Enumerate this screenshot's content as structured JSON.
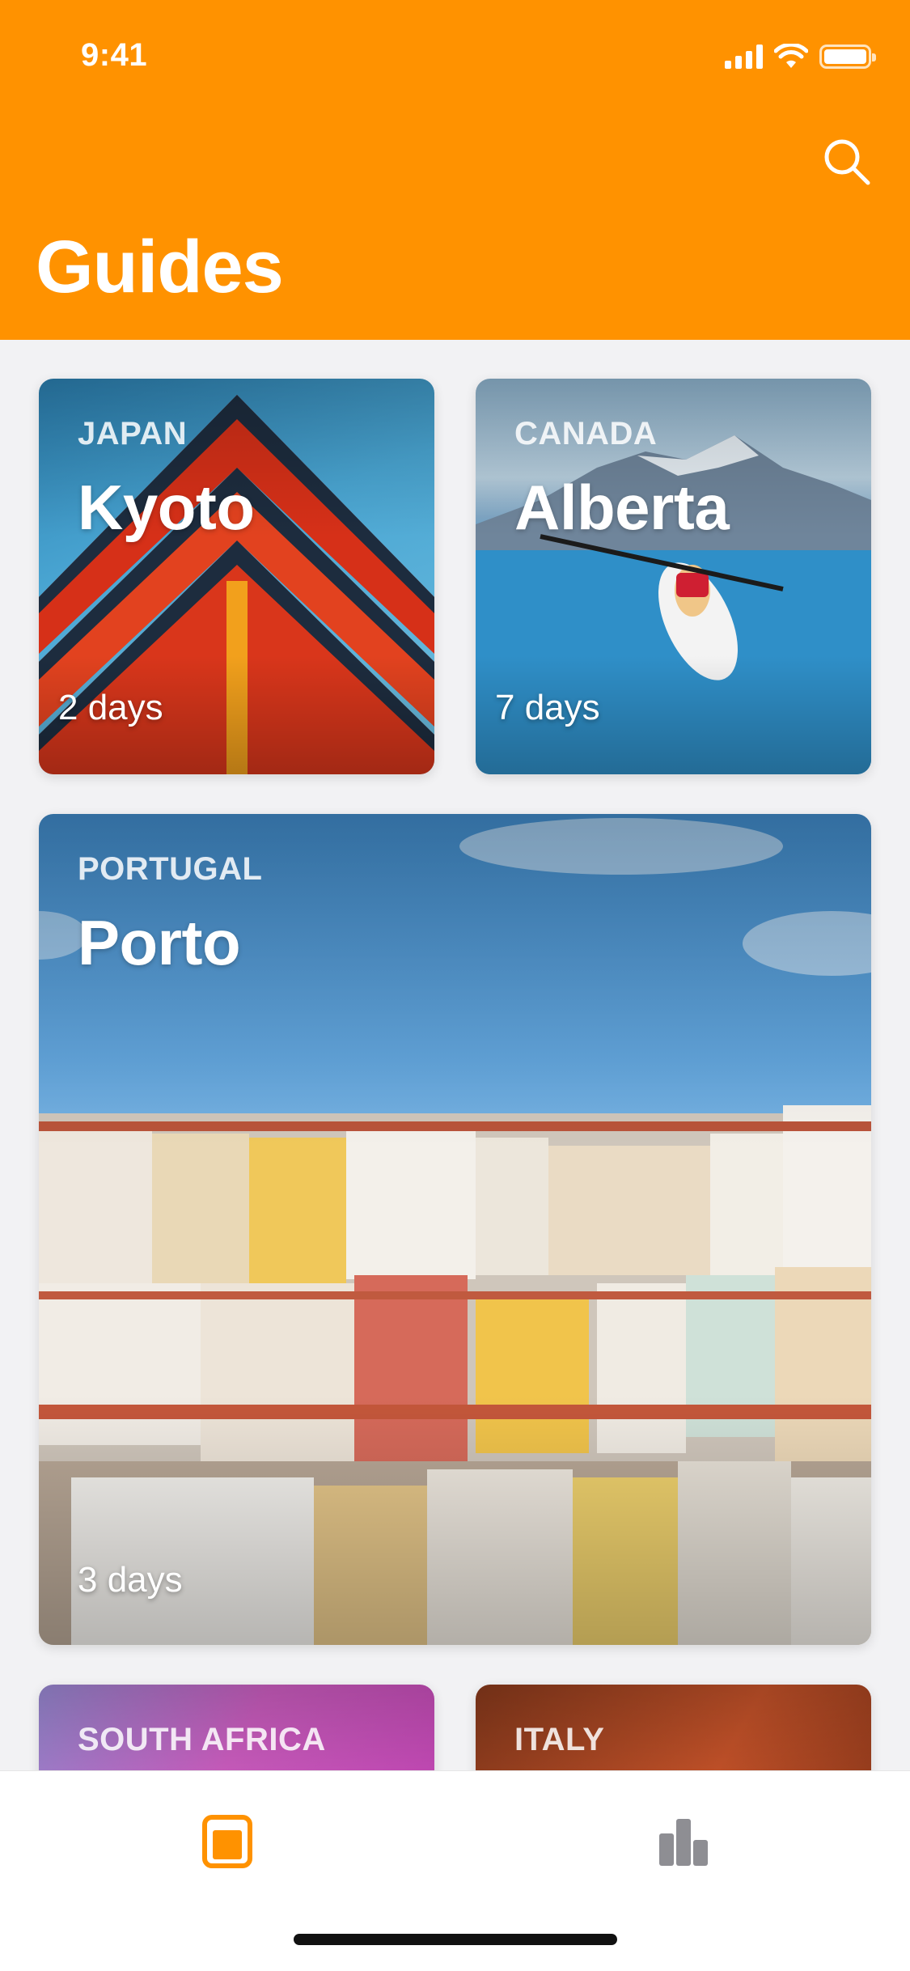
{
  "status_bar": {
    "time": "9:41",
    "icons": [
      "cellular-signal-icon",
      "wifi-icon",
      "battery-icon"
    ]
  },
  "header": {
    "title": "Guides",
    "background_color": "#FF9200",
    "search_icon": "search-icon"
  },
  "guides": [
    {
      "country": "JAPAN",
      "city": "Kyoto",
      "duration": "2 days"
    },
    {
      "country": "CANADA",
      "city": "Alberta",
      "duration": "7 days"
    },
    {
      "country": "PORTUGAL",
      "city": "Porto",
      "duration": "3 days"
    },
    {
      "country": "SOUTH AFRICA"
    },
    {
      "country": "ITALY"
    }
  ],
  "tab_bar": {
    "items": [
      {
        "icon": "guides-book-icon",
        "selected": true,
        "color": "#FF9200"
      },
      {
        "icon": "stats-bar-chart-icon",
        "selected": false,
        "color": "#8E8E93"
      }
    ]
  }
}
